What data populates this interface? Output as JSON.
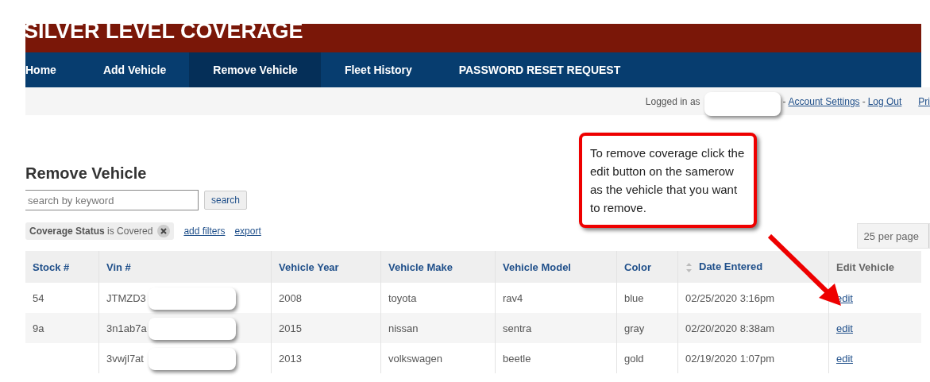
{
  "header": {
    "title": "SILVER LEVEL COVERAGE"
  },
  "nav": [
    {
      "label": "Home",
      "selected": false
    },
    {
      "label": "Add Vehicle",
      "selected": false
    },
    {
      "label": "Remove Vehicle",
      "selected": true
    },
    {
      "label": "Fleet History",
      "selected": false
    },
    {
      "label": "PASSWORD RESET REQUEST",
      "selected": false
    }
  ],
  "account_bar": {
    "logged_in_label": "Logged in as",
    "user_redacted": true,
    "items": [
      {
        "kind": "sep",
        "text": "-"
      },
      {
        "kind": "link",
        "text": "Account Settings"
      },
      {
        "kind": "sep",
        "text": "-"
      },
      {
        "kind": "link",
        "text": "Log Out"
      },
      {
        "kind": "link",
        "text": "Pri"
      }
    ]
  },
  "heading": "Remove Vehicle",
  "search": {
    "placeholder": "search by keyword",
    "button": "search"
  },
  "filter": {
    "text": "**Coverage Status** is Covered"
  },
  "links": [
    "add filters",
    "export"
  ],
  "per_page": {
    "value": "25 per page"
  },
  "table": {
    "columns": [
      {
        "label": "Stock #",
        "kind": "link",
        "sort_icon": false
      },
      {
        "label": "Vin #",
        "kind": "link",
        "sort_icon": false
      },
      {
        "label": "Vehicle Year",
        "kind": "link",
        "sort_icon": false
      },
      {
        "label": "Vehicle Make",
        "kind": "link",
        "sort_icon": false
      },
      {
        "label": "Vehicle Model",
        "kind": "link",
        "sort_icon": false
      },
      {
        "label": "Color",
        "kind": "link",
        "sort_icon": false
      },
      {
        "label": "Date Entered",
        "kind": "link",
        "sort_icon": true
      },
      {
        "label": "Edit Vehicle",
        "kind": "plain",
        "sort_icon": false
      }
    ],
    "rows": [
      {
        "stock": "54",
        "vin": "JTMZD3",
        "year": "2008",
        "make": "toyota",
        "model": "rav4",
        "paint": "blue",
        "date": "02/25/2020 3:16pm",
        "action": "edit",
        "vin_redacted": true
      },
      {
        "stock": "9a",
        "vin": "3n1ab7a",
        "year": "2015",
        "make": "nissan",
        "model": "sentra",
        "paint": "gray",
        "date": "02/20/2020 8:38am",
        "action": "edit",
        "vin_redacted": true
      },
      {
        "vin": "3vwjl7at",
        "year": "2013",
        "make": "volkswagen",
        "model": "beetle",
        "paint": "gold",
        "date": "02/19/2020 1:07pm",
        "action": "edit",
        "vin_redacted": true
      }
    ]
  },
  "callout": {
    "text": "To remove coverage click the edit button on the samerow as the vehicle that you want to remove."
  }
}
